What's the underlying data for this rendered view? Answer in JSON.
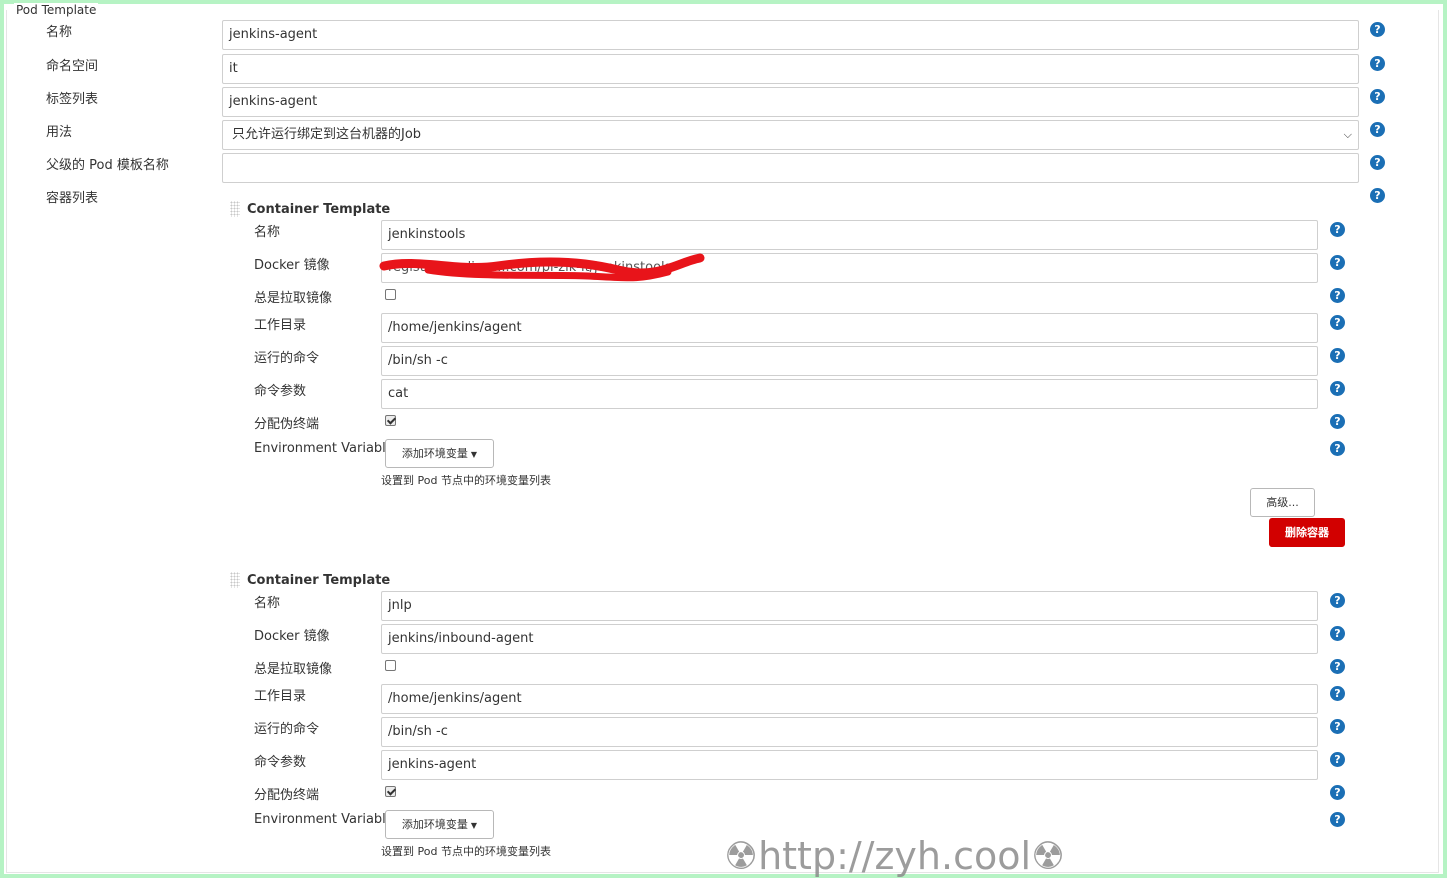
{
  "pod_template": {
    "legend": "Pod Template",
    "fields": {
      "name": {
        "label": "名称",
        "value": "jenkins-agent"
      },
      "namespace": {
        "label": "命名空间",
        "value": "it"
      },
      "labels": {
        "label": "标签列表",
        "value": "jenkins-agent"
      },
      "usage": {
        "label": "用法",
        "value": "只允许运行绑定到这台机器的Job"
      },
      "parent": {
        "label": "父级的 Pod 模板名称",
        "value": ""
      },
      "containers": {
        "label": "容器列表"
      }
    }
  },
  "containers": [
    {
      "title": "Container Template",
      "name_label": "名称",
      "name": "jenkinstools",
      "image_label": "Docker 镜像",
      "image": "registry.c...ali...y....com/pi-zik-it/jenkinstools",
      "pull_label": "总是拉取镜像",
      "always_pull": false,
      "workdir_label": "工作目录",
      "workdir": "/home/jenkins/agent",
      "command_label": "运行的命令",
      "command": "/bin/sh -c",
      "args_label": "命令参数",
      "args": "cat",
      "tty_label": "分配伪终端",
      "tty": true,
      "env_label": "Environment Variables",
      "env_button": "添加环境变量",
      "env_hint": "设置到 Pod 节点中的环境变量列表",
      "advanced_button": "高级...",
      "delete_button": "删除容器"
    },
    {
      "title": "Container Template",
      "name_label": "名称",
      "name": "jnlp",
      "image_label": "Docker 镜像",
      "image": "jenkins/inbound-agent",
      "pull_label": "总是拉取镜像",
      "always_pull": false,
      "workdir_label": "工作目录",
      "workdir": "/home/jenkins/agent",
      "command_label": "运行的命令",
      "command": "/bin/sh -c",
      "args_label": "命令参数",
      "args": "jenkins-agent",
      "tty_label": "分配伪终端",
      "tty": true,
      "env_label": "Environment Variables",
      "env_button": "添加环境变量",
      "env_hint": "设置到 Pod 节点中的环境变量列表"
    }
  ],
  "help_glyph": "?",
  "watermark": "☢http://zyh.cool☢",
  "colors": {
    "help": "#1b6fb5",
    "delete": "#d20000",
    "frame": "#b6f3c4",
    "redaction": "#e8141a"
  }
}
